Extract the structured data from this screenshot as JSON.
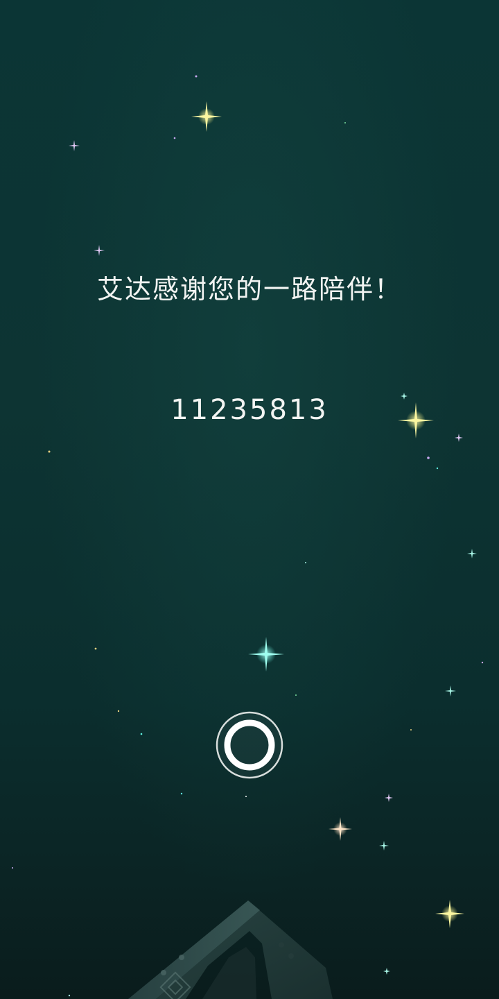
{
  "ending": {
    "message": "艾达感谢您的一路陪伴！",
    "code": "11235813"
  },
  "controls": {
    "continue_icon": "ring-icon"
  },
  "colors": {
    "background_top": "#0b3535",
    "background_bottom": "#0a1c1c",
    "text": "#f2f4f2",
    "star_yellow": "#f6f07a",
    "star_cyan": "#5ff2e0",
    "star_violet": "#c9a8f0"
  }
}
